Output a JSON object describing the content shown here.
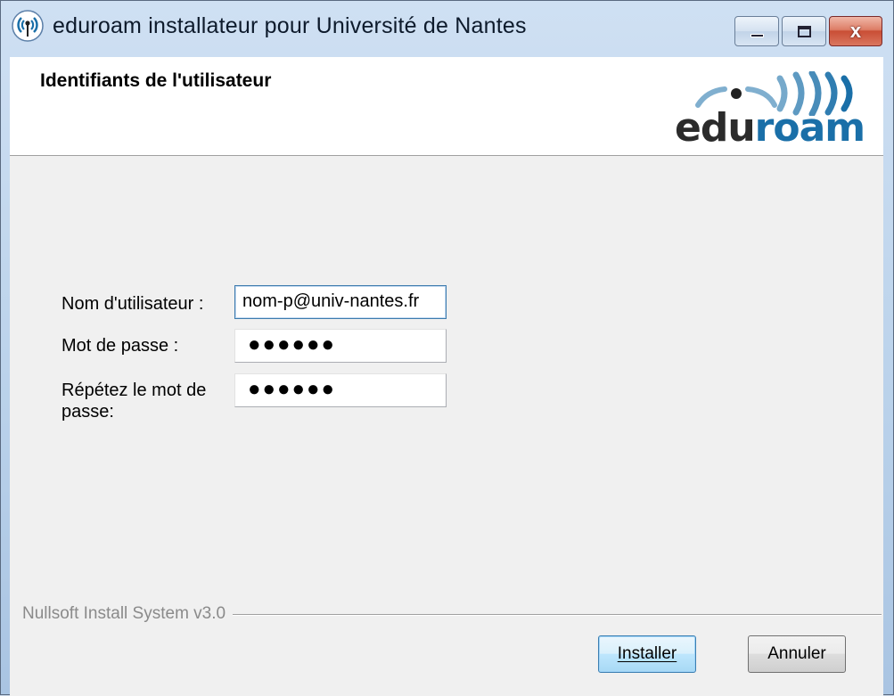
{
  "window": {
    "title": "eduroam installateur pour Université de Nantes",
    "close_glyph": "x"
  },
  "header": {
    "title": "Identifiants de l'utilisateur",
    "logo": {
      "edu": "edu",
      "roam": "roam",
      "color_brand": "#1a6fa8"
    }
  },
  "form": {
    "username_label": "Nom d'utilisateur :",
    "username_value": "nom-p@univ-nantes.fr",
    "password_label": "Mot de passe :",
    "password_value": "●●●●●●",
    "repeat_label": "Répétez le mot de passe:",
    "repeat_value": "●●●●●●"
  },
  "footer": {
    "branding": "Nullsoft Install System v3.0",
    "install_button": "Installer",
    "cancel_button": "Annuler"
  },
  "icons": [
    "eduroam-app-icon",
    "minimize-icon",
    "maximize-icon",
    "close-icon"
  ]
}
